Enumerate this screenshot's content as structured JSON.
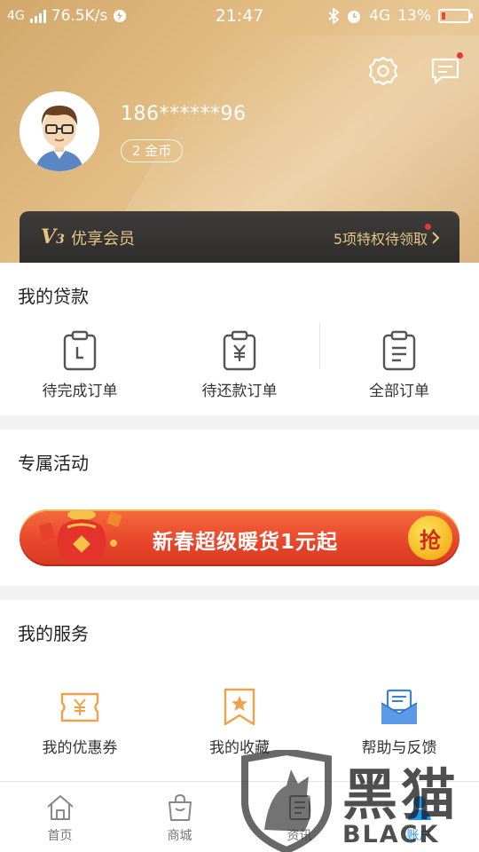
{
  "status_bar": {
    "network": "4G",
    "speed": "76.5K/s",
    "time": "21:47",
    "network_right": "4G",
    "battery": "13%",
    "battery_level": 0.13
  },
  "header": {
    "settings_icon": "gear-icon",
    "message_icon": "chat-bubble-icon",
    "phone": "186******96",
    "coins": "2 金币"
  },
  "vip": {
    "level_prefix": "V",
    "level_num": "3",
    "title": "优享会员",
    "privileges": "5项特权待领取"
  },
  "loans": {
    "title": "我的贷款",
    "items": [
      {
        "label": "待完成订单",
        "icon": "clipboard-clock-icon"
      },
      {
        "label": "待还款订单",
        "icon": "clipboard-yen-icon"
      },
      {
        "label": "全部订单",
        "icon": "clipboard-list-icon"
      }
    ]
  },
  "activity": {
    "title": "专属活动",
    "banner_text": "新春超级暖货1元起",
    "grab_label": "抢"
  },
  "services": {
    "title": "我的服务",
    "items": [
      {
        "label": "我的优惠券",
        "icon": "coupon-icon"
      },
      {
        "label": "我的收藏",
        "icon": "bookmark-star-icon"
      },
      {
        "label": "帮助与反馈",
        "icon": "feedback-mail-icon"
      }
    ]
  },
  "bottom_nav": [
    {
      "label": "首页",
      "icon": "home-icon"
    },
    {
      "label": "商城",
      "icon": "shopping-bag-icon"
    },
    {
      "label": "资讯",
      "icon": "news-icon"
    },
    {
      "label": "账户",
      "icon": "account-icon"
    }
  ],
  "watermark": {
    "text": "黑猫",
    "sub": "BLACK CAT"
  },
  "colors": {
    "gold": "#e6c486",
    "accent_blue": "#2196f3",
    "icon_orange": "#f0a24a"
  }
}
